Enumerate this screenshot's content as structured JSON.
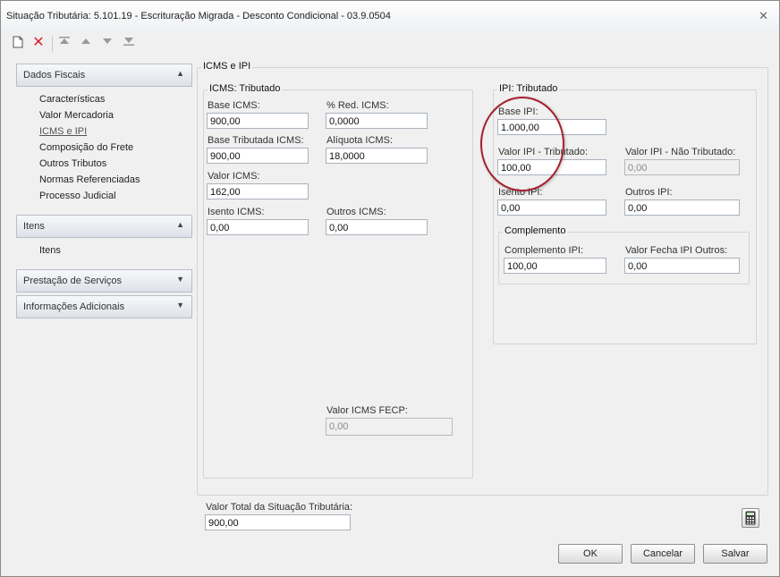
{
  "window": {
    "title": "Situação Tributária: 5.101.19 - Escrituração Migrada - Desconto Condicional - 03.9.0504"
  },
  "toolbar": {
    "icons": [
      "new-icon",
      "delete-icon",
      "first-icon",
      "up-icon",
      "down-icon",
      "last-icon"
    ]
  },
  "sidebar": {
    "dados_fiscais": {
      "label": "Dados Fiscais",
      "items": [
        "Características",
        "Valor Mercadoria",
        "ICMS e IPI",
        "Composição do Frete",
        "Outros Tributos",
        "Normas Referenciadas",
        "Processo Judicial"
      ]
    },
    "itens": {
      "label": "Itens",
      "items": [
        "Itens"
      ]
    },
    "prestacao": {
      "label": "Prestação de Serviços"
    },
    "informacoes": {
      "label": "Informações Adicionais"
    }
  },
  "main": {
    "group_title": "ICMS e IPI",
    "icms": {
      "title": "ICMS: Tributado",
      "base_icms": {
        "label": "Base ICMS:",
        "value": "900,00"
      },
      "red_icms": {
        "label": "% Red. ICMS:",
        "value": "0,0000"
      },
      "base_tributada": {
        "label": "Base Tributada ICMS:",
        "value": "900,00"
      },
      "aliquota": {
        "label": "Alíquota ICMS:",
        "value": "18,0000"
      },
      "valor_icms": {
        "label": "Valor ICMS:",
        "value": "162,00"
      },
      "isento_icms": {
        "label": "Isento ICMS:",
        "value": "0,00"
      },
      "outros_icms": {
        "label": "Outros ICMS:",
        "value": "0,00"
      },
      "fecp": {
        "label": "Valor ICMS FECP:",
        "value": "0,00"
      }
    },
    "ipi": {
      "title": "IPI: Tributado",
      "base_ipi": {
        "label": "Base IPI:",
        "value": "1.000,00"
      },
      "valor_trib": {
        "label": "Valor IPI - Tributado:",
        "value": "100,00"
      },
      "valor_nao_trib": {
        "label": "Valor IPI - Não Tributado:",
        "value": "0,00"
      },
      "isento_ipi": {
        "label": "Isento IPI:",
        "value": "0,00"
      },
      "outros_ipi": {
        "label": "Outros IPI:",
        "value": "0,00"
      },
      "complemento": {
        "title": "Complemento",
        "comp_ipi": {
          "label": "Complemento IPI:",
          "value": "100,00"
        },
        "fecha": {
          "label": "Valor Fecha IPI Outros:",
          "value": "0,00"
        }
      }
    },
    "total": {
      "label": "Valor Total da Situação Tributária:",
      "value": "900,00"
    }
  },
  "buttons": {
    "ok": "OK",
    "cancel": "Cancelar",
    "save": "Salvar"
  },
  "colors": {
    "highlight_circle": "#a3202c",
    "delete_icon": "#d9242b"
  }
}
